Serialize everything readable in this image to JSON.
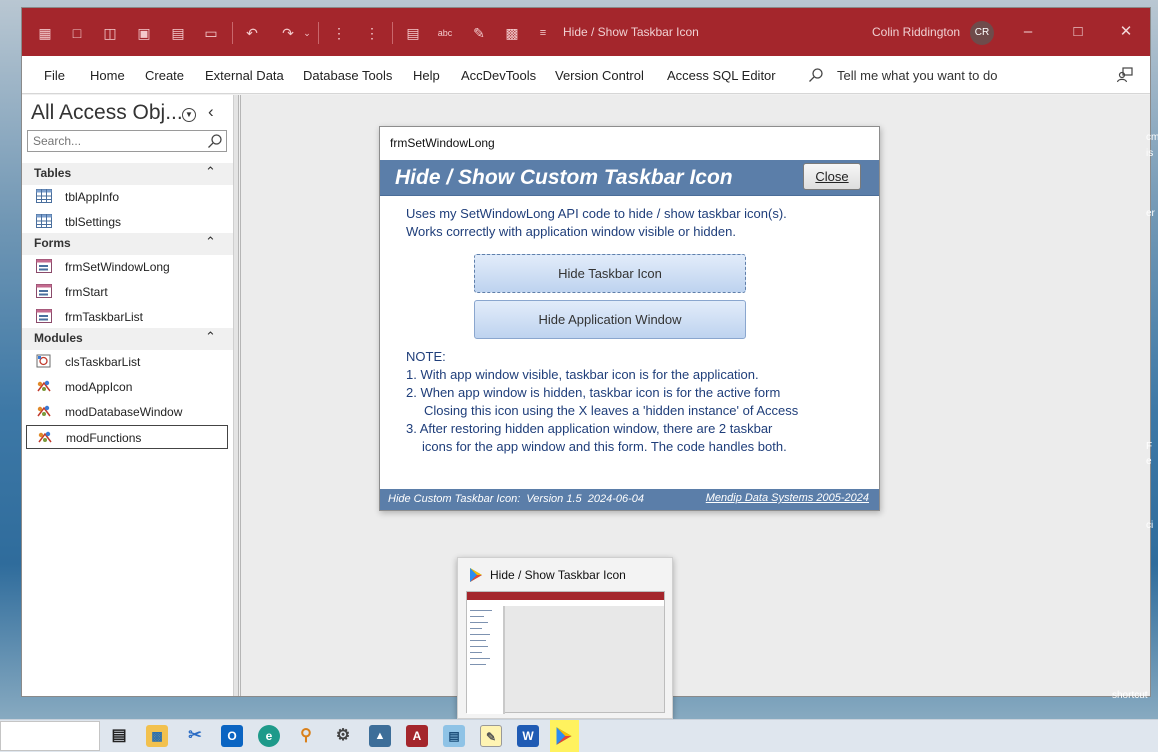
{
  "window": {
    "title": "Hide / Show Taskbar Icon",
    "user_name": "Colin Riddington",
    "user_initials": "CR",
    "accent_color": "#a4262c"
  },
  "ribbon": {
    "menu": [
      "File",
      "Home",
      "Create",
      "External Data",
      "Database Tools",
      "Help",
      "AccDevTools",
      "Version Control",
      "Access SQL Editor"
    ],
    "tell_me": "Tell me what you want to do"
  },
  "nav": {
    "title": "All Access Obj...",
    "search_placeholder": "Search...",
    "groups": {
      "tables": {
        "label": "Tables",
        "items": [
          "tblAppInfo",
          "tblSettings"
        ]
      },
      "forms": {
        "label": "Forms",
        "items": [
          "frmSetWindowLong",
          "frmStart",
          "frmTaskbarList"
        ]
      },
      "modules": {
        "label": "Modules",
        "items": [
          "clsTaskbarList",
          "modAppIcon",
          "modDatabaseWindow",
          "modFunctions"
        ]
      }
    },
    "selected_item": "modFunctions"
  },
  "form": {
    "caption": "frmSetWindowLong",
    "heading": "Hide / Show Custom Taskbar Icon",
    "close_label": "Close",
    "desc_line1": "Uses my SetWindowLong API code to hide / show taskbar icon(s).",
    "desc_line2": "Works correctly with application window visible or hidden.",
    "hide_taskbar_label": "Hide Taskbar Icon",
    "hide_appwin_label": "Hide Application Window",
    "note_title": "NOTE:",
    "note1": "1.  With app window visible, taskbar icon is for the application.",
    "note2a": "2.  When app window is hidden, taskbar icon is for the active form",
    "note2b": "Closing this icon using the X leaves a 'hidden instance' of Access",
    "note3a": "3.  After restoring hidden application window, there are 2 taskbar",
    "note3b": "icons for the app window and this form. The code handles both.",
    "footer_left": "Hide Custom Taskbar Icon:  Version 1.5  2024-06-04",
    "footer_right": "Mendip Data Systems 2005-2024",
    "header_color": "#5b7ea9"
  },
  "thumbnail": {
    "title": "Hide / Show Taskbar Icon"
  },
  "taskbar": {
    "icons": [
      "task-view-icon",
      "file-explorer-icon",
      "snipping-tool-icon",
      "outlook-icon",
      "edge-icon",
      "search-tool-icon",
      "settings-icon",
      "resource-monitor-icon",
      "access-icon",
      "notepad-icon",
      "notes-icon",
      "word-icon",
      "play-app-icon"
    ],
    "active_icon": "play-app-icon",
    "active_highlight": "#fff25e"
  },
  "desktop_edge": {
    "text_lines": [
      "cm",
      "is",
      "er",
      "F",
      "e",
      "ci",
      "shortcut"
    ]
  }
}
